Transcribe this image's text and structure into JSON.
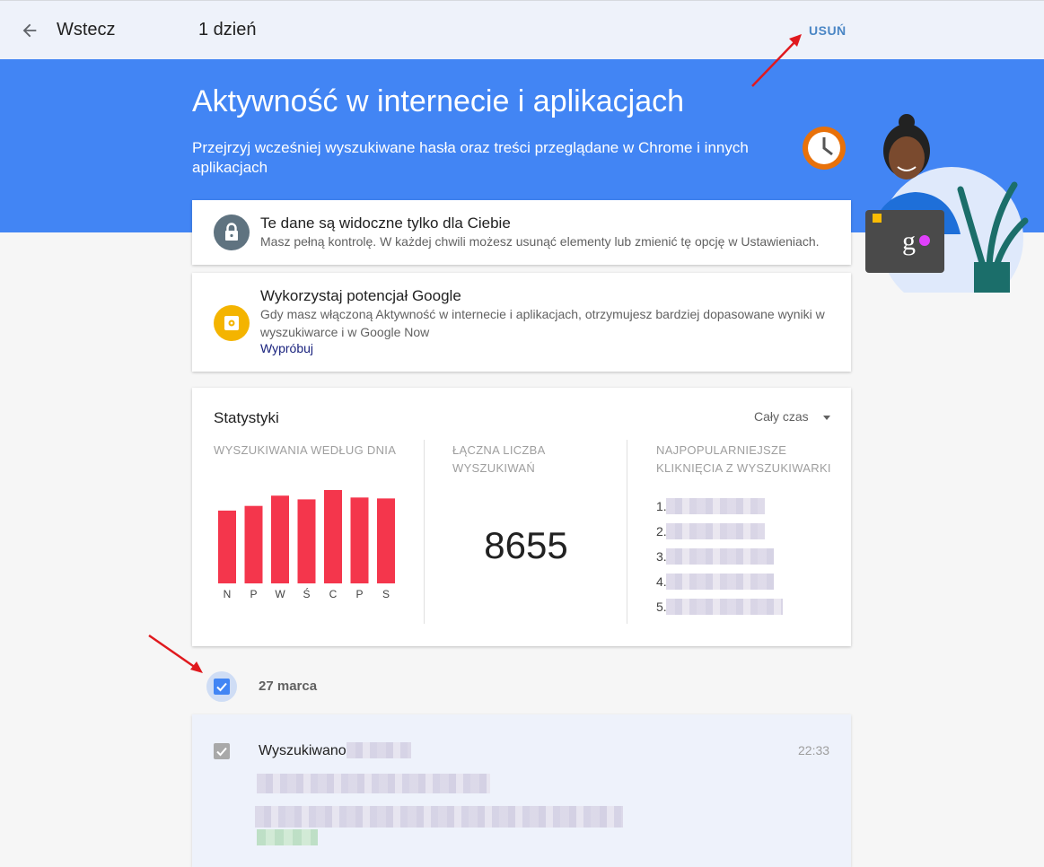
{
  "topbar": {
    "back_label": "Wstecz",
    "period_label": "1 dzień",
    "delete_label": "USUŃ",
    "accent_color": "#4a86c5"
  },
  "hero": {
    "title": "Aktywność w internecie i aplikacjach",
    "subtitle": "Przejrzyj wcześniej wyszukiwane hasła oraz treści przeglądane w Chrome i innych aplikacjach",
    "background_color": "#4285f4"
  },
  "privacy_card": {
    "icon": "lock-icon",
    "title": "Te dane są widoczne tylko dla Ciebie",
    "description": "Masz pełną kontrolę. W każdej chwili możesz usunąć elementy lub zmienić tę opcję w Ustawieniach."
  },
  "google_card": {
    "icon": "gear-icon",
    "title": "Wykorzystaj potencjał Google",
    "description": "Gdy masz włączoną Aktywność w internecie i aplikacjach, otrzymujesz bardziej dopasowane wyniki w wyszukiwarce i w Google Now",
    "link_label": "Wypróbuj"
  },
  "stats": {
    "title": "Statystyki",
    "range_selected": "Cały czas",
    "searches_by_day_heading": "WYSZUKIWANIA WEDŁUG DNIA",
    "total_heading": "ŁĄCZNA LICZBA WYSZUKIWAŃ",
    "total_value": "8655",
    "top_clicks_heading": "NAJPOPULARNIEJSZE KLIKNIĘCIA Z WYSZUKIWARKI",
    "top_clicks_ranks": [
      "1.",
      "2.",
      "3.",
      "4.",
      "5."
    ]
  },
  "chart_data": {
    "type": "bar",
    "categories": [
      "N",
      "P",
      "W",
      "Ś",
      "C",
      "P",
      "S"
    ],
    "values": [
      78,
      83,
      94,
      90,
      100,
      92,
      91
    ],
    "bar_color": "#f4364c"
  },
  "history": {
    "day_label": "27 marca",
    "entries": [
      {
        "label": "Wyszukiwano",
        "time": "22:33"
      }
    ]
  }
}
